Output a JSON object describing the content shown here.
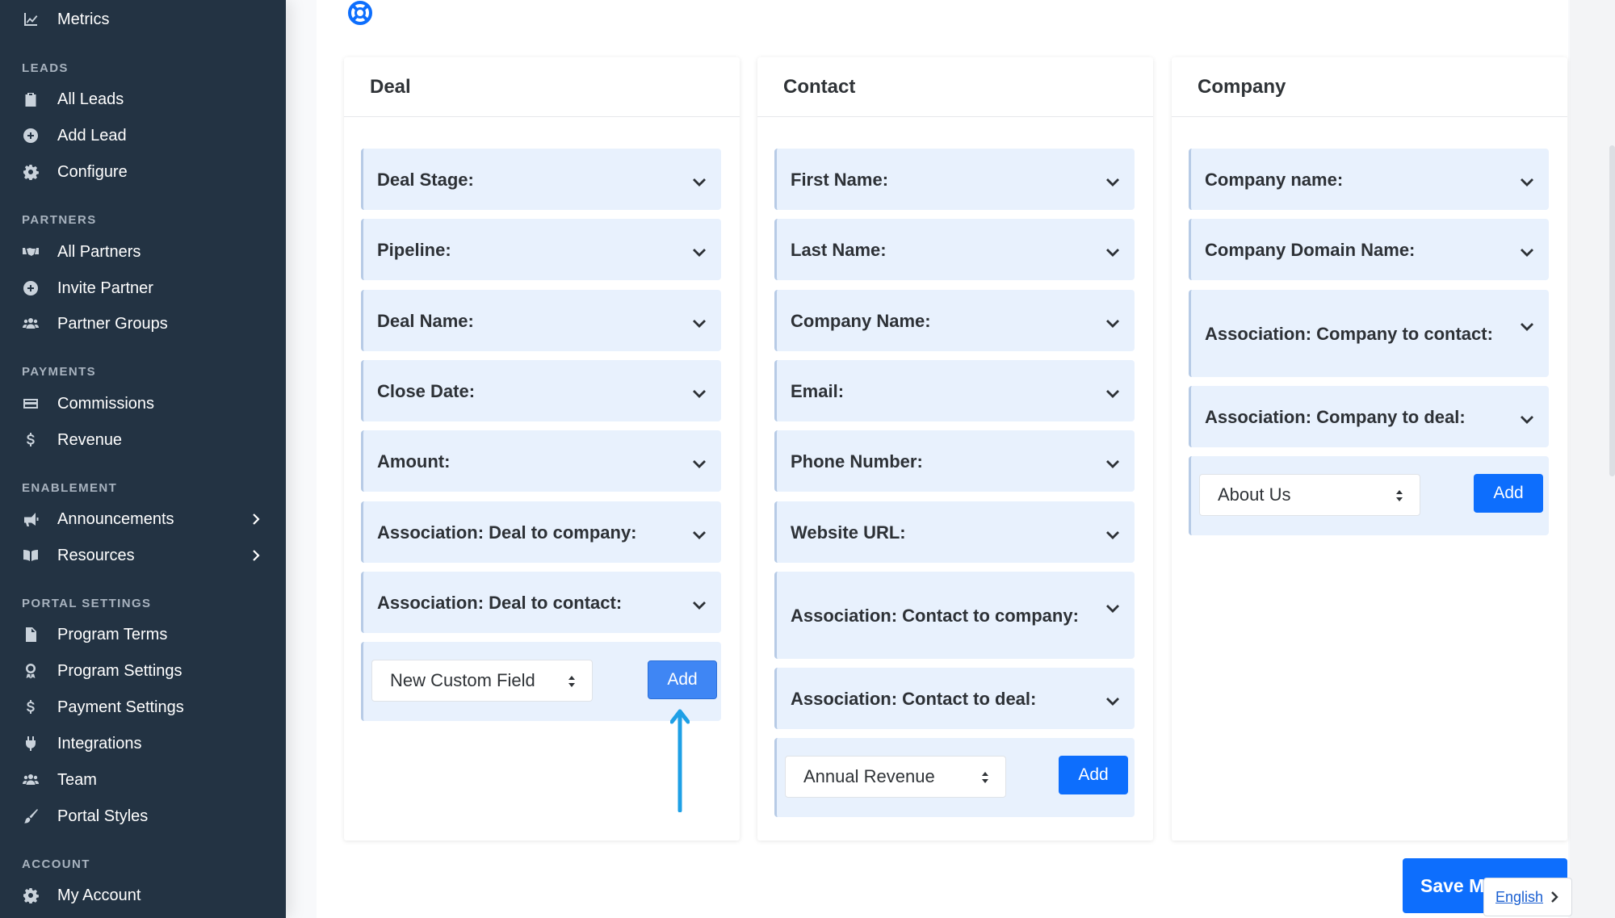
{
  "sidebar": {
    "top_item": {
      "label": "Metrics",
      "icon": "chart-line-icon"
    },
    "sections": [
      {
        "title": "LEADS",
        "items": [
          {
            "label": "All Leads",
            "icon": "clipboard-icon"
          },
          {
            "label": "Add Lead",
            "icon": "plus-circle-icon"
          },
          {
            "label": "Configure",
            "icon": "gear-icon"
          }
        ]
      },
      {
        "title": "PARTNERS",
        "items": [
          {
            "label": "All Partners",
            "icon": "handshake-icon"
          },
          {
            "label": "Invite Partner",
            "icon": "plus-circle-icon"
          },
          {
            "label": "Partner Groups",
            "icon": "users-icon"
          }
        ]
      },
      {
        "title": "PAYMENTS",
        "items": [
          {
            "label": "Commissions",
            "icon": "credit-card-icon"
          },
          {
            "label": "Revenue",
            "icon": "dollar-icon"
          }
        ]
      },
      {
        "title": "ENABLEMENT",
        "items": [
          {
            "label": "Announcements",
            "icon": "megaphone-icon"
          },
          {
            "label": "Resources",
            "icon": "book-icon"
          }
        ]
      },
      {
        "title": "PORTAL SETTINGS",
        "items": [
          {
            "label": "Program Terms",
            "icon": "file-icon"
          },
          {
            "label": "Program Settings",
            "icon": "award-icon"
          },
          {
            "label": "Payment Settings",
            "icon": "dollar-icon"
          },
          {
            "label": "Integrations",
            "icon": "plug-icon"
          },
          {
            "label": "Team",
            "icon": "users-icon"
          },
          {
            "label": "Portal Styles",
            "icon": "brush-icon"
          }
        ]
      },
      {
        "title": "ACCOUNT",
        "items": [
          {
            "label": "My Account",
            "icon": "gear-icon"
          }
        ]
      }
    ]
  },
  "columns": {
    "deal": {
      "title": "Deal",
      "fields": [
        "Deal Stage:",
        "Pipeline:",
        "Deal Name:",
        "Close Date:",
        "Amount:",
        "Association: Deal to company:",
        "Association: Deal to contact:"
      ],
      "select_value": "New Custom Field",
      "add_label": "Add"
    },
    "contact": {
      "title": "Contact",
      "fields": [
        "First Name:",
        "Last Name:",
        "Company Name:",
        "Email:",
        "Phone Number:",
        "Website URL:",
        "Association: Contact to company:",
        "Association: Contact to deal:"
      ],
      "select_value": "Annual Revenue",
      "add_label": "Add"
    },
    "company": {
      "title": "Company",
      "fields": [
        "Company name:",
        "Company Domain Name:",
        "Association: Company to contact:",
        "Association: Company to deal:"
      ],
      "select_value": "About Us",
      "add_label": "Add"
    }
  },
  "save_label": "Save M",
  "language": "English",
  "colors": {
    "sidebar_bg": "#233343",
    "primary": "#0d6efd",
    "field_bg": "#e8f1fd",
    "annotation_arrow": "#1ea0e6"
  }
}
